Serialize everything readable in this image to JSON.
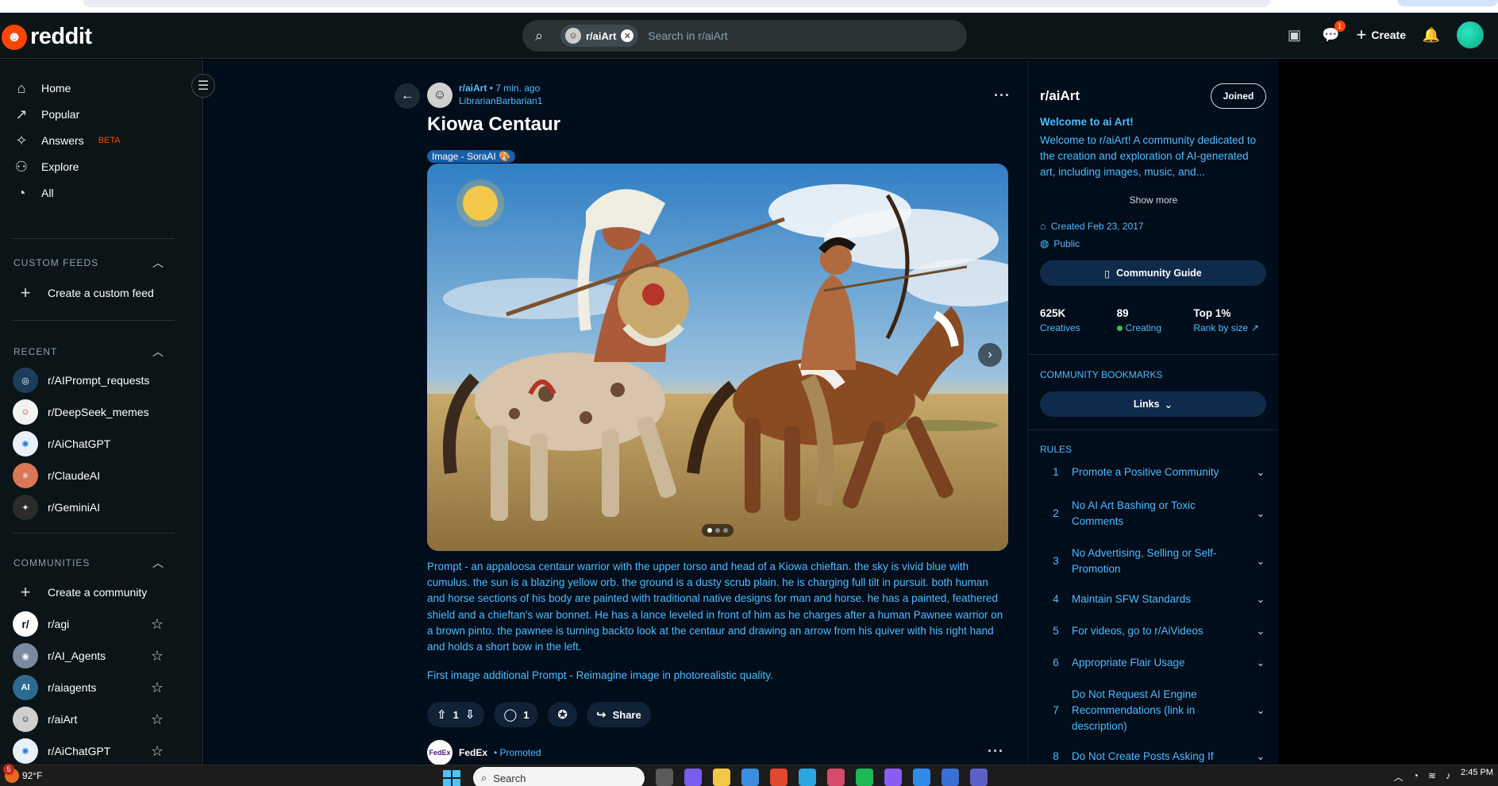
{
  "header": {
    "brand": "reddit",
    "search_chip": "r/aiArt",
    "search_placeholder": "Search in r/aiArt",
    "create_label": "Create",
    "chat_badge": "1"
  },
  "sidebar": {
    "nav": [
      {
        "label": "Home",
        "icon": "home-icon"
      },
      {
        "label": "Popular",
        "icon": "popular-icon"
      },
      {
        "label": "Answers",
        "icon": "answers-icon",
        "badge": "BETA"
      },
      {
        "label": "Explore",
        "icon": "explore-icon"
      },
      {
        "label": "All",
        "icon": "all-icon"
      }
    ],
    "custom_feeds_heading": "CUSTOM FEEDS",
    "create_custom_feed": "Create a custom feed",
    "recent_heading": "RECENT",
    "recent": [
      {
        "label": "r/AIPrompt_requests",
        "color": "#1c3d5a"
      },
      {
        "label": "r/DeepSeek_memes",
        "color": "#f2f2f2"
      },
      {
        "label": "r/AiChatGPT",
        "color": "#e8f1fb"
      },
      {
        "label": "r/ClaudeAI",
        "color": "#d97757"
      },
      {
        "label": "r/GeminiAI",
        "color": "#2b2b2b"
      }
    ],
    "communities_heading": "COMMUNITIES",
    "create_community": "Create a community",
    "communities": [
      {
        "label": "r/agi",
        "color": "#ffffff"
      },
      {
        "label": "r/AI_Agents",
        "color": "#7a8aa0"
      },
      {
        "label": "r/aiagents",
        "color": "#2d6a8f"
      },
      {
        "label": "r/aiArt",
        "color": "#cfcfcf"
      },
      {
        "label": "r/AiChatGPT",
        "color": "#e8f1fb"
      }
    ]
  },
  "post": {
    "subreddit": "r/aiArt",
    "time": "• 7 min. ago",
    "author": "LibrarianBarbarian1",
    "title": "Kiowa Centaur",
    "flair": "Image - SoraAI 🎨",
    "image_count": 3,
    "image_index": 1,
    "body1": "Prompt - an appaloosa centaur warrior with the upper torso and head of a Kiowa chieftan. the sky is vivid blue with cumulus. the sun is a blazing yellow orb. the ground is a dusty scrub plain. he is charging full tilt in pursuit. both human and horse sections of his body are painted with traditional native designs for man and horse. he has a painted, feathered shield and a chieftan's war bonnet. He has a lance leveled in front of him as he charges after a human Pawnee warrior on a brown pinto. the pawnee is turning backto look at the centaur and drawing an arrow from his quiver with his right hand and holds a short bow in the left.",
    "body2": "First image additional Prompt - Reimagine image in photorealistic quality.",
    "votes": "1",
    "comments": "1",
    "share_label": "Share"
  },
  "promo": {
    "name": "FedEx",
    "tag": "• Promoted",
    "logo_text": "FedEx"
  },
  "community": {
    "name": "r/aiArt",
    "joined_label": "Joined",
    "welcome": "Welcome to ai Art!",
    "description": "Welcome to r/aiArt! A community dedicated to the creation and exploration of AI-generated art, including images, music, and...",
    "show_more": "Show more",
    "created": "Created Feb 23, 2017",
    "visibility": "Public",
    "guide_label": "Community Guide",
    "stats": [
      {
        "value": "625K",
        "label": "Creatives"
      },
      {
        "value": "89",
        "label": "Creating"
      },
      {
        "value": "Top 1%",
        "label": "Rank by size"
      }
    ],
    "bookmarks_heading": "COMMUNITY BOOKMARKS",
    "links_label": "Links",
    "rules_heading": "RULES",
    "rules": [
      {
        "num": "1",
        "text": "Promote a Positive Community"
      },
      {
        "num": "2",
        "text": "No AI Art Bashing or Toxic Comments"
      },
      {
        "num": "3",
        "text": "No Advertising, Selling or Self-Promotion"
      },
      {
        "num": "4",
        "text": "Maintain SFW Standards"
      },
      {
        "num": "5",
        "text": "For videos, go to r/AiVideos"
      },
      {
        "num": "6",
        "text": "Appropriate Flair Usage"
      },
      {
        "num": "7",
        "text": "Do Not Request AI Engine Recommendations (link in description)"
      },
      {
        "num": "8",
        "text": "Do Not Create Posts Asking If"
      }
    ]
  },
  "taskbar": {
    "temperature": "92°F",
    "weather_badge": "5",
    "search_label": "Search",
    "time": "2:45 PM"
  }
}
